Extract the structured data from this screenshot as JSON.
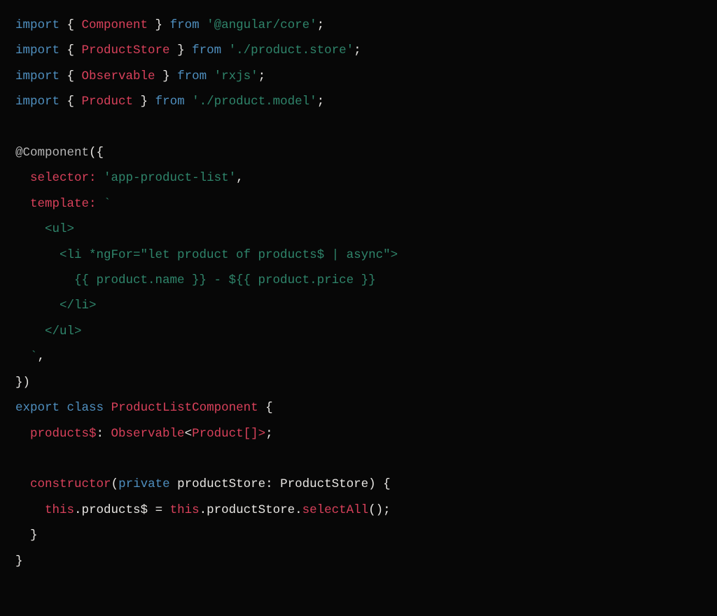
{
  "tokens": {
    "kw_import": "import",
    "kw_from": "from",
    "kw_export": "export",
    "kw_class": "class",
    "kw_private": "private",
    "sym_Component": "Component",
    "sym_ProductStore": "ProductStore",
    "sym_Observable": "Observable",
    "sym_Product": "Product",
    "sym_ProductListComponent": "ProductListComponent",
    "str_angular_core": "'@angular/core'",
    "str_product_store": "'./product.store'",
    "str_rxjs": "'rxjs'",
    "str_product_model": "'./product.model'",
    "decorator": "@Component",
    "prop_selector": "selector:",
    "str_selector_val": "'app-product-list'",
    "prop_template": "template:",
    "tpl_tick_open": "`",
    "tpl_ul_open": "    <ul>",
    "tpl_li_open": "      <li *ngFor=\"let product of products$ | async\">",
    "tpl_li_body": "        {{ product.name }} - ${{ product.price }}",
    "tpl_li_close": "      </li>",
    "tpl_ul_close": "    </ul>",
    "tpl_tick_close": "  `",
    "prop_products": "products$",
    "type_products": "Observable",
    "type_products_param": "Product",
    "type_products_suffix": "[]>",
    "ctor": "constructor",
    "param_name": "productStore",
    "param_type": "ProductStore",
    "this": "this",
    "member_products": "products$",
    "member_store": "productStore",
    "method_selectAll": "selectAll"
  }
}
